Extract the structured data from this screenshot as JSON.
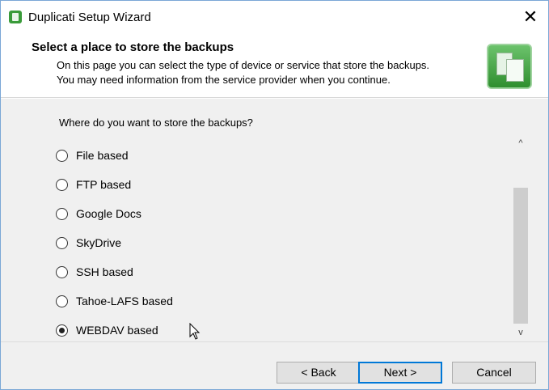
{
  "window": {
    "title": "Duplicati Setup Wizard",
    "close_glyph": "✕"
  },
  "header": {
    "title": "Select a place to store the backups",
    "description_line1": "On this page you can select the type of device or service that store the backups.",
    "description_line2": "You may need information from the service provider when you continue."
  },
  "body": {
    "question": "Where do you want to store the backups?",
    "options": [
      {
        "label": "File based",
        "checked": false
      },
      {
        "label": "FTP based",
        "checked": false
      },
      {
        "label": "Google Docs",
        "checked": false
      },
      {
        "label": "SkyDrive",
        "checked": false
      },
      {
        "label": "SSH based",
        "checked": false
      },
      {
        "label": "Tahoe-LAFS based",
        "checked": false
      },
      {
        "label": "WEBDAV based",
        "checked": true
      }
    ],
    "scroll_up_glyph": "^",
    "scroll_down_glyph": "v"
  },
  "footer": {
    "back_label": "< Back",
    "next_label": "Next >",
    "cancel_label": "Cancel"
  },
  "colors": {
    "accent": "#0078d7",
    "icon_green": "#3a9b3a"
  }
}
